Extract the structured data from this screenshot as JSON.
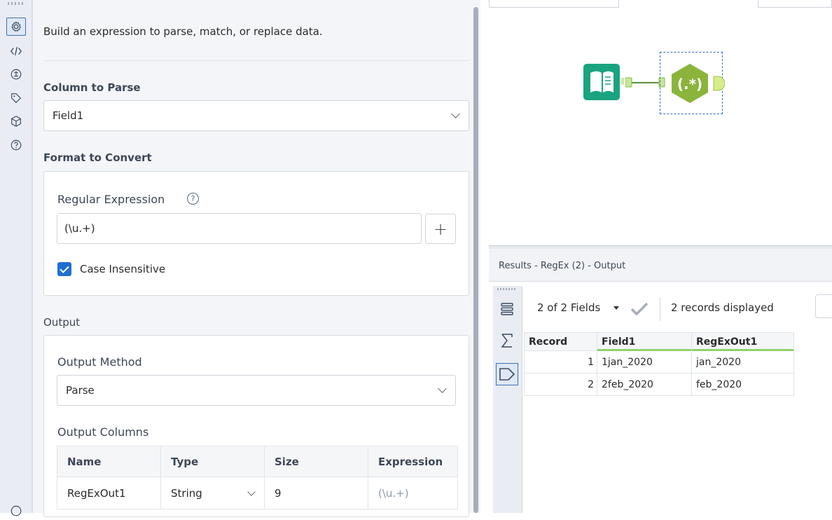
{
  "config": {
    "description": "Build an expression to parse, match, or replace data.",
    "column_to_parse": {
      "label": "Column to Parse",
      "value": "Field1"
    },
    "format_to_convert": {
      "label": "Format to Convert",
      "regex_label": "Regular Expression",
      "regex_value": "(\\u.+)",
      "plus_label": "+",
      "case_insensitive_label": "Case Insensitive",
      "case_insensitive_checked": true
    },
    "output": {
      "label": "Output",
      "method_label": "Output Method",
      "method_value": "Parse",
      "columns_label": "Output Columns",
      "headers": [
        "Name",
        "Type",
        "Size",
        "Expression"
      ],
      "rows": [
        {
          "name": "RegExOut1",
          "type": "String",
          "size": "9",
          "expression": "(\\u.+)"
        }
      ]
    }
  },
  "results": {
    "title": "Results - RegEx (2) - Output",
    "fields_label": "2 of 2 Fields",
    "records_label": "2 records displayed",
    "headers": [
      "Record",
      "Field1",
      "RegExOut1"
    ],
    "rows": [
      {
        "record": "1",
        "field1": "1jan_2020",
        "out": "jan_2020"
      },
      {
        "record": "2",
        "field1": "2feb_2020",
        "out": "feb_2020"
      }
    ]
  },
  "workflow": {
    "tools": [
      "input-data-icon",
      "regex-tool-icon"
    ],
    "colors": {
      "input_tool": "#1aa37f",
      "regex_tool": "#8ab43b",
      "connector": "#7bbf3a"
    }
  },
  "icons": {
    "rail": [
      "gear-icon",
      "code-icon",
      "anchor-icon",
      "tag-icon",
      "cube-icon",
      "help-circle-icon"
    ],
    "results_rail": [
      "list-icon",
      "sigma-icon",
      "tag-shape-icon"
    ]
  }
}
